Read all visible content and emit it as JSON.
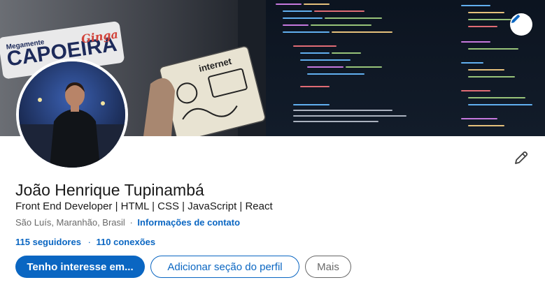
{
  "banner": {
    "logo_top_text": "Megamente",
    "logo_main_text": "CAPOEIRA",
    "logo_script_text": "Ginga",
    "sticker_text": "internet"
  },
  "profile": {
    "name": "João Henrique Tupinambá",
    "headline": "Front End Developer | HTML | CSS | JavaScript | React",
    "location": "São Luís, Maranhão, Brasil",
    "separator": "·",
    "contact_info": "Informações de contato",
    "followers": "115 seguidores",
    "connections_dot": "·",
    "connections": "110 conexões"
  },
  "actions": {
    "open_to": "Tenho interesse em...",
    "add_section": "Adicionar seção do perfil",
    "more": "Mais"
  },
  "icons": {
    "banner_edit": "pencil-icon",
    "intro_edit": "pencil-icon"
  },
  "colors": {
    "accent": "#0a66c2",
    "text_primary": "#191919",
    "text_secondary": "#666666"
  }
}
